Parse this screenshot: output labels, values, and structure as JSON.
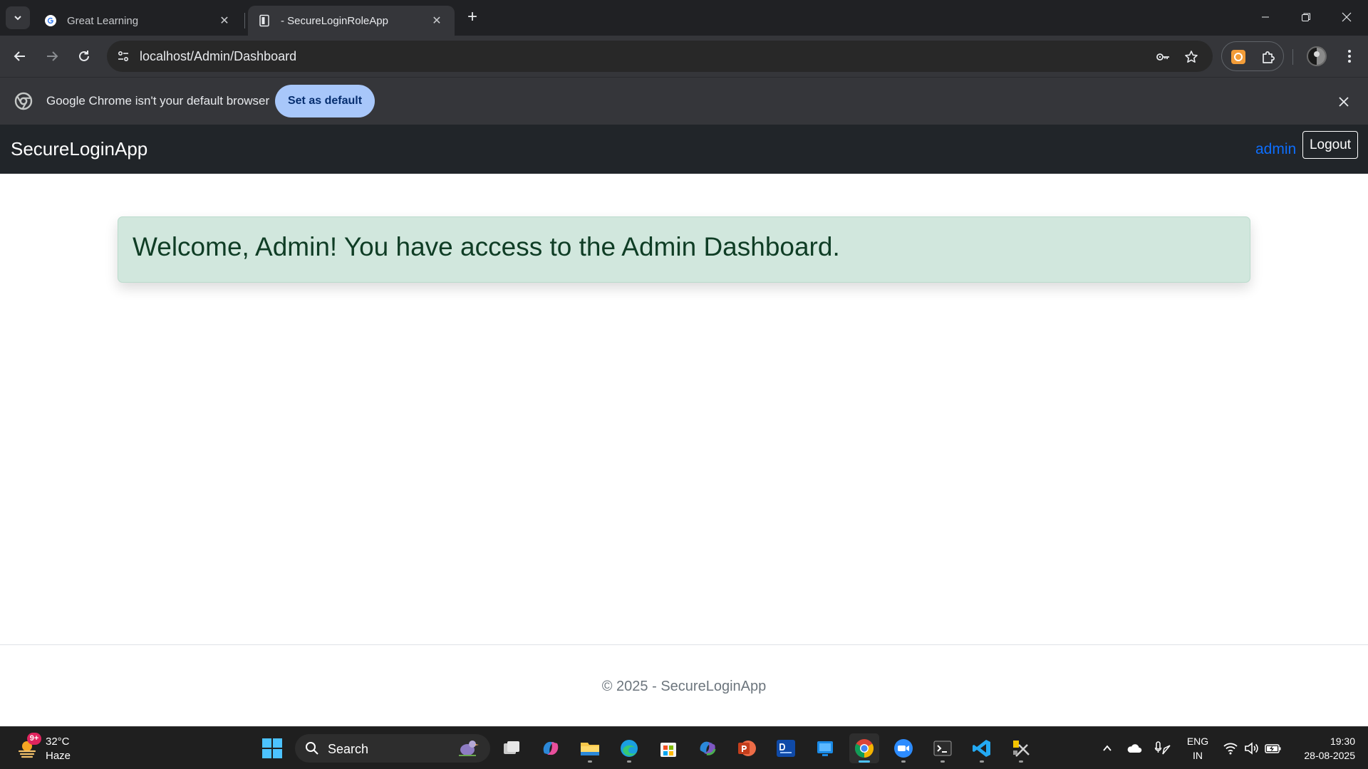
{
  "browser": {
    "tabs": [
      {
        "title": "Great Learning",
        "active": false
      },
      {
        "title": "- SecureLoginRoleApp",
        "active": true
      }
    ],
    "url": "localhost/Admin/Dashboard",
    "infobar": {
      "message": "Google Chrome isn't your default browser",
      "button_label": "Set as default"
    }
  },
  "app": {
    "brand": "SecureLoginApp",
    "user_name": "admin",
    "logout_label": "Logout",
    "welcome_message": "Welcome, Admin! You have access to the Admin Dashboard.",
    "footer": "© 2025 - SecureLoginApp"
  },
  "taskbar": {
    "weather_temp": "32°C",
    "weather_condition": "Haze",
    "weather_badge": "9+",
    "search_label": "Search",
    "language_line1": "ENG",
    "language_line2": "IN",
    "time": "19:30",
    "date": "28-08-2025"
  },
  "colors": {
    "chrome_dark": "#202124",
    "toolbar": "#35363a",
    "app_navbar": "#212529",
    "alert_bg": "#d1e7dd",
    "alert_text": "#0f3d25",
    "link_blue": "#0d6efd",
    "infobar_button": "#a8c7fa"
  }
}
